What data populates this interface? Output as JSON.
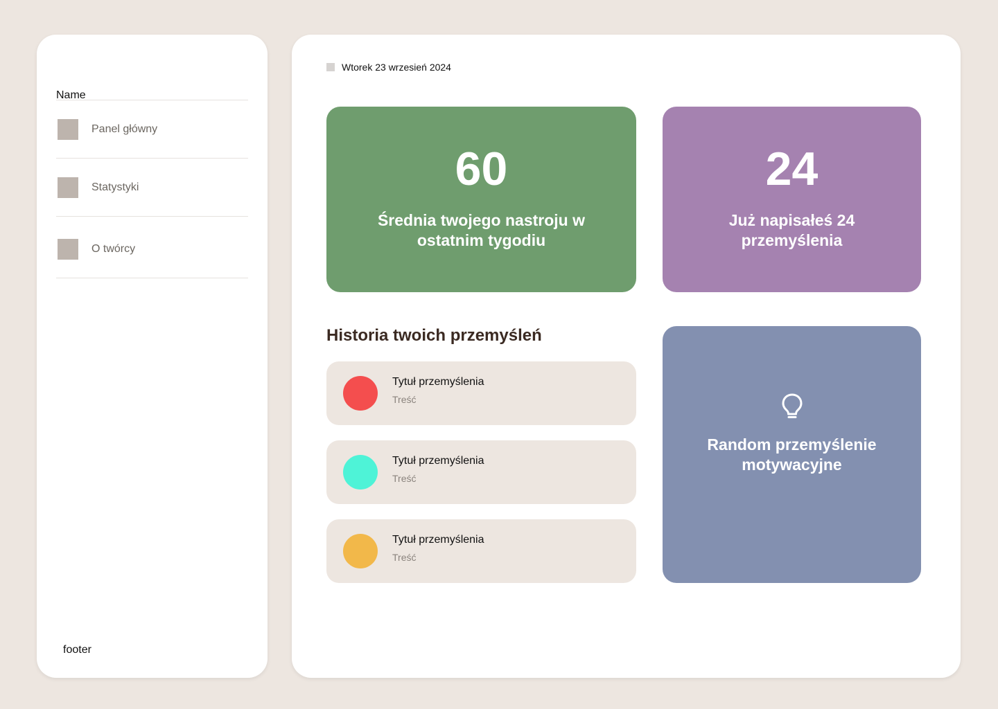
{
  "sidebar": {
    "name": "Name",
    "items": [
      {
        "label": "Panel główny"
      },
      {
        "label": "Statystyki"
      },
      {
        "label": "O twórcy"
      }
    ],
    "footer": "footer"
  },
  "main": {
    "date": "Wtorek 23 wrzesień 2024",
    "mood_card": {
      "value": "60",
      "caption": "Średnia twojego nastroju w ostatnim tygodiu",
      "color": "#6f9d6e"
    },
    "count_card": {
      "value": "24",
      "caption": "Już napisałeś 24 przemyślenia",
      "color": "#a582b0"
    },
    "history": {
      "title": "Historia twoich przemyśleń",
      "entries": [
        {
          "title": "Tytuł przemyślenia",
          "body": "Treść",
          "color": "#f44e4e"
        },
        {
          "title": "Tytuł przemyślenia",
          "body": "Treść",
          "color": "#4ef3d7"
        },
        {
          "title": "Tytuł przemyślenia",
          "body": "Treść",
          "color": "#f2b84a"
        }
      ]
    },
    "motivation_card": {
      "icon": "lightbulb-icon",
      "caption": "Random przemyślenie motywacyjne",
      "color": "#8390b0"
    }
  }
}
